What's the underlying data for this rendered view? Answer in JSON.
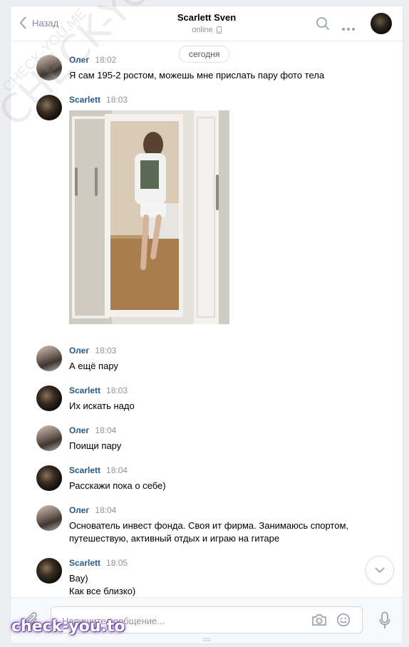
{
  "header": {
    "back_label": "Назад",
    "title": "Scarlett Sven",
    "status": "online"
  },
  "date_divider": "сегодня",
  "messages": [
    {
      "author": "Олег",
      "time": "18:02",
      "text": "Я сам 195-2 ростом, можешь мне прислать пару фото тела",
      "avatar": "oleg"
    },
    {
      "author": "Scarlett",
      "time": "18:03",
      "text": "",
      "avatar": "scarlett",
      "has_photo": true
    },
    {
      "author": "Олег",
      "time": "18:03",
      "text": "А ещё пару",
      "avatar": "oleg"
    },
    {
      "author": "Scarlett",
      "time": "18:03",
      "text": "Их искать надо",
      "avatar": "scarlett"
    },
    {
      "author": "Олег",
      "time": "18:04",
      "text": "Поищи пару",
      "avatar": "oleg"
    },
    {
      "author": "Scarlett",
      "time": "18:04",
      "text": "Расскажи пока о себе)",
      "avatar": "scarlett"
    },
    {
      "author": "Олег",
      "time": "18:04",
      "text": "Основатель инвест фонда. Своя ит фирма. Занимаюсь спортом, путешествую, активный отдых и играю на гитаре",
      "avatar": "oleg"
    },
    {
      "author": "Scarlett",
      "time": "18:05",
      "text": "Вау)",
      "text2": "Как все близко)",
      "avatar": "scarlett"
    }
  ],
  "composer": {
    "placeholder": "Напишите сообщение..."
  },
  "watermarks": {
    "diagonal": "CHECK-YOU.ME",
    "small": "CHECK-YOU.ME",
    "bottom": "check-you.to"
  },
  "colors": {
    "author": "#2a5885",
    "time": "#939393",
    "icon": "#99a2ad",
    "background": "#edeef0"
  }
}
